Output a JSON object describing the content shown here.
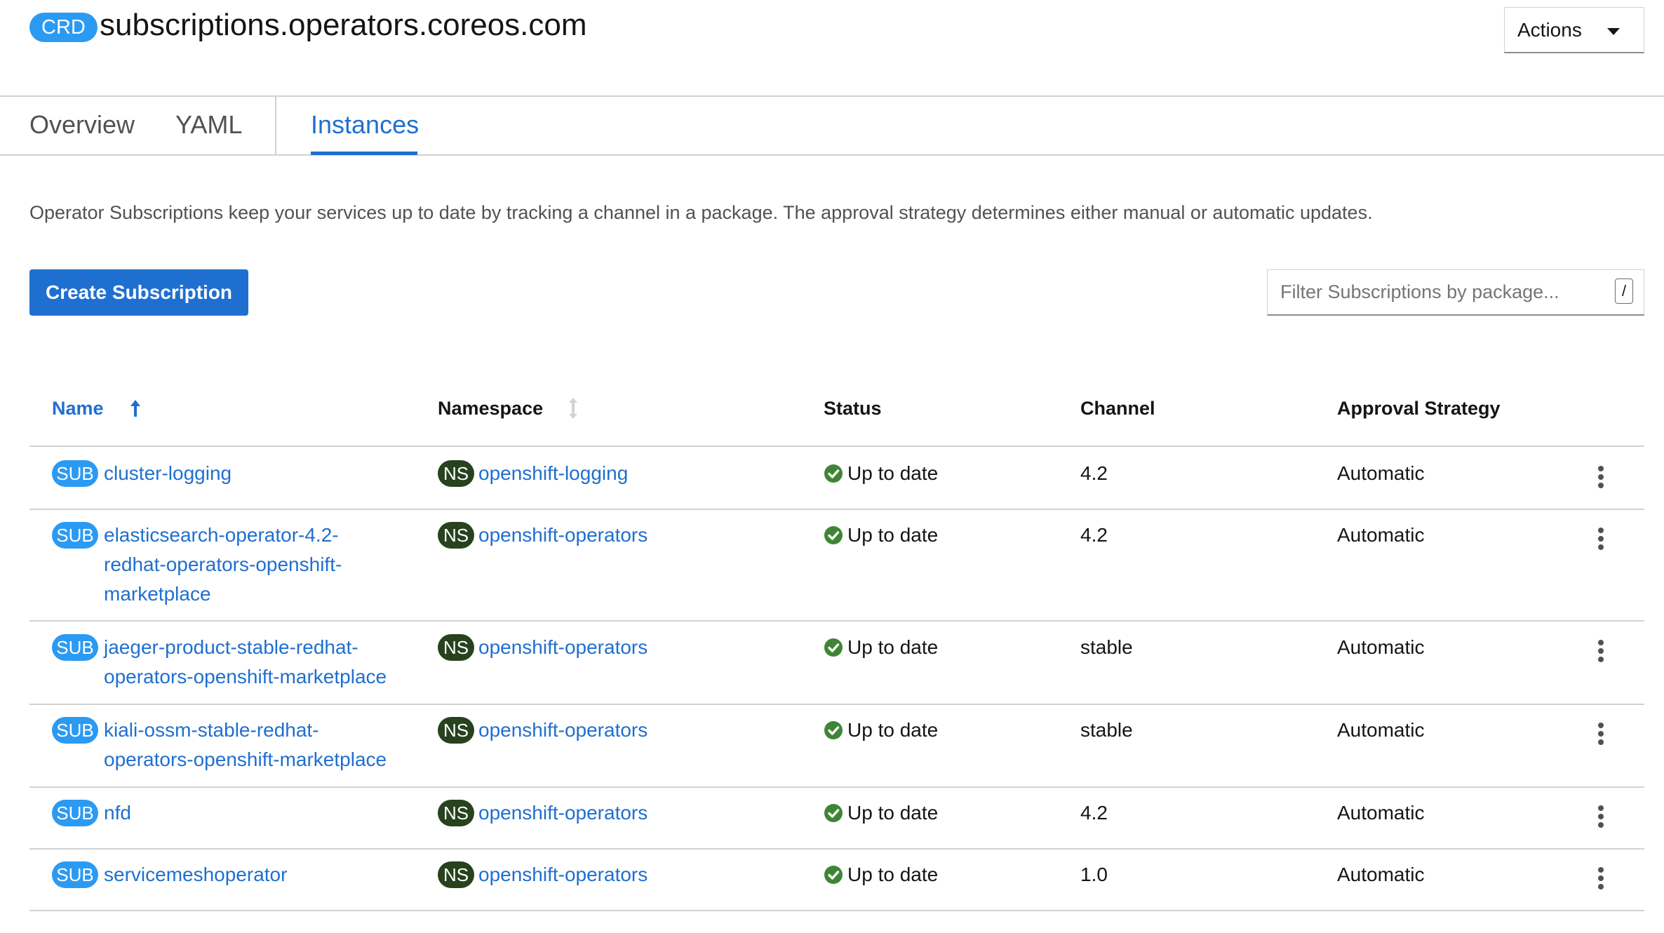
{
  "header": {
    "badge": "CRD",
    "title": "subscriptions.operators.coreos.com",
    "actions_label": "Actions"
  },
  "tabs": [
    {
      "label": "Overview",
      "active": false
    },
    {
      "label": "YAML",
      "active": false
    },
    {
      "label": "Instances",
      "active": true
    }
  ],
  "description": "Operator Subscriptions keep your services up to date by tracking a channel in a package. The approval strategy determines either manual or automatic updates.",
  "toolbar": {
    "create_label": "Create Subscription",
    "filter_placeholder": "Filter Subscriptions by package...",
    "filter_shortcut": "/"
  },
  "table": {
    "columns": [
      "Name",
      "Namespace",
      "Status",
      "Channel",
      "Approval Strategy"
    ],
    "sort": {
      "column": "Name",
      "direction": "ascending"
    },
    "sub_badge": "SUB",
    "ns_badge": "NS",
    "rows": [
      {
        "name_lines": [
          "cluster-logging"
        ],
        "namespace": "openshift-logging",
        "status": "Up to date",
        "channel": "4.2",
        "approval": "Automatic"
      },
      {
        "name_lines": [
          "elasticsearch-operator-4.2-",
          "redhat-operators-openshift-",
          "marketplace"
        ],
        "namespace": "openshift-operators",
        "status": "Up to date",
        "channel": "4.2",
        "approval": "Automatic"
      },
      {
        "name_lines": [
          "jaeger-product-stable-redhat-",
          "operators-openshift-marketplace"
        ],
        "namespace": "openshift-operators",
        "status": "Up to date",
        "channel": "stable",
        "approval": "Automatic"
      },
      {
        "name_lines": [
          "kiali-ossm-stable-redhat-",
          "operators-openshift-marketplace"
        ],
        "namespace": "openshift-operators",
        "status": "Up to date",
        "channel": "stable",
        "approval": "Automatic"
      },
      {
        "name_lines": [
          "nfd"
        ],
        "namespace": "openshift-operators",
        "status": "Up to date",
        "channel": "4.2",
        "approval": "Automatic"
      },
      {
        "name_lines": [
          "servicemeshoperator"
        ],
        "namespace": "openshift-operators",
        "status": "Up to date",
        "channel": "1.0",
        "approval": "Automatic"
      }
    ]
  },
  "colors": {
    "link": "#1f6fd0",
    "primary_button": "#1f6fd0",
    "sub_badge": "#2b9af3",
    "ns_badge": "#27421d",
    "status_ok": "#3e8635"
  },
  "icons": {
    "sort_active": "arrow-up-icon",
    "sort_inactive": "sort-icon",
    "status": "check-circle-icon",
    "row_menu": "kebab-icon",
    "actions": "caret-down-icon"
  }
}
